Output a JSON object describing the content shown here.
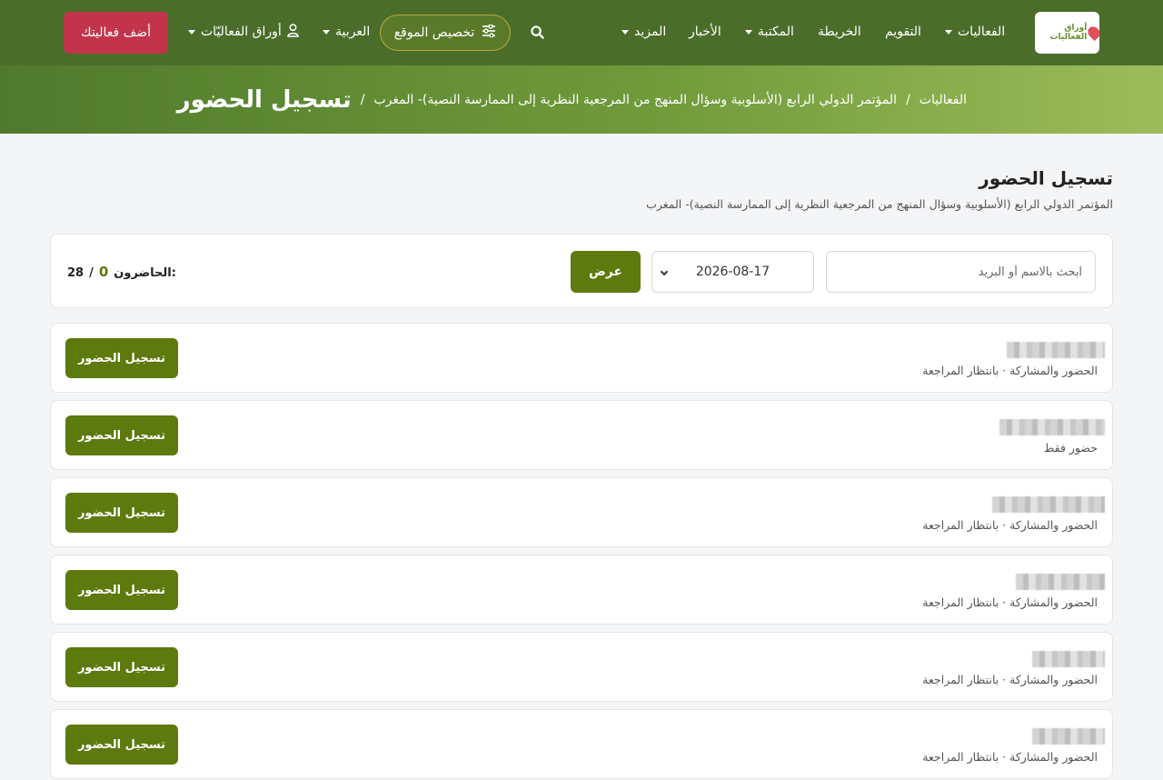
{
  "navbar": {
    "logo_text": "أوراق الفعاليات",
    "items": [
      {
        "label": "الفعاليات",
        "has_dropdown": true
      },
      {
        "label": "التقويم",
        "has_dropdown": false
      },
      {
        "label": "الخريطة",
        "has_dropdown": false
      },
      {
        "label": "المكتبة",
        "has_dropdown": true
      },
      {
        "label": "الأخبار",
        "has_dropdown": false
      },
      {
        "label": "المزيد",
        "has_dropdown": true
      }
    ],
    "customize_label": "تخصيص الموقع",
    "language_label": "العربية",
    "account_label": "أوراق الفعاليّات",
    "add_event_label": "أضف فعاليتك",
    "accent_color": "#4a6e2a",
    "add_event_color": "#c2344a"
  },
  "breadcrumb": {
    "items": [
      "الفعاليات",
      "المؤتمر الدولي الرابع (الأسلوبية وسؤال المنهج من المرجعية النظرية إلى الممارسة النصية)- المغرب"
    ],
    "separator": "/",
    "current": "تسجيل الحضور"
  },
  "page": {
    "title": "تسجيل الحضور",
    "subtitle": "المؤتمر الدولي الرابع (الأسلوبية وسؤال المنهج من المرجعية النظرية إلى الممارسة النصية)- المغرب"
  },
  "filter": {
    "search_placeholder": "ابحث بالاسم أو البريد",
    "date_value": "2026-08-17",
    "show_label": "عرض",
    "counter_label": "الحاضرون:",
    "present_count": "0",
    "count_separator": "/",
    "total_count": "28",
    "button_color": "#5d7a0e"
  },
  "attendees": [
    {
      "name": "[blurred]",
      "status": "الحضور والمشاركة · بانتظار المراجعة",
      "button_label": "تسجيل الحضور"
    },
    {
      "name": "[blurred]",
      "status": "حضور فقط",
      "button_label": "تسجيل الحضور"
    },
    {
      "name": "[blurred]",
      "status": "الحضور والمشاركة · بانتظار المراجعة",
      "button_label": "تسجيل الحضور"
    },
    {
      "name": "[blurred]",
      "status": "الحضور والمشاركة · بانتظار المراجعة",
      "button_label": "تسجيل الحضور"
    },
    {
      "name": "[blurred]",
      "status": "الحضور والمشاركة · بانتظار المراجعة",
      "button_label": "تسجيل الحضور"
    },
    {
      "name": "[blurred]",
      "status": "الحضور والمشاركة · بانتظار المراجعة",
      "button_label": "تسجيل الحضور"
    }
  ]
}
